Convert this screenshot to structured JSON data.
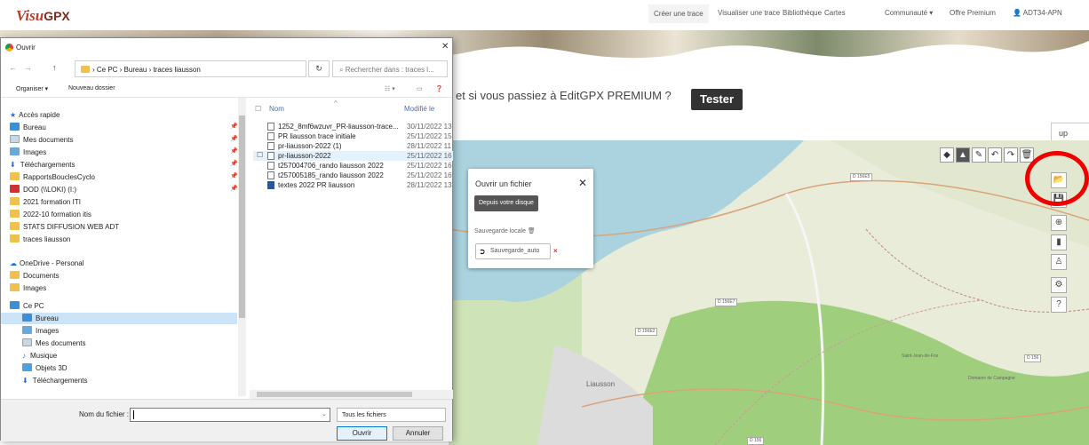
{
  "app": {
    "logo_main": "Visu",
    "logo_gpx": "GPX"
  },
  "topnav": {
    "items": [
      "Créer une trace",
      "Visualiser une trace",
      "Bibliothèque",
      "Cartes",
      "Communauté ▾",
      "Offre Premium"
    ],
    "user": "ADT34-APN"
  },
  "promo": {
    "text": "et si vous passiez à EditGPX PREMIUM ?",
    "button": "Tester"
  },
  "map": {
    "up_button": "up",
    "toolbar": [
      "◆",
      "▲",
      "✎",
      "↶",
      "↷",
      "🗑"
    ],
    "side_tools": [
      "📂",
      "💾",
      "⊕",
      "▮",
      "♙",
      "⚙",
      "?"
    ],
    "road_labels": [
      "D 156E5",
      "D 156E7",
      "D 156E2",
      "D 156",
      "D 156"
    ],
    "places": [
      "Liausson",
      "Domaine de Campagne",
      "Saint-Jean-de-Fos"
    ]
  },
  "popup": {
    "title": "Ouvrir un fichier",
    "close": "✕",
    "disk_button": "Depuis votre disque",
    "local_save_label": "Sauvegarde locale 🗑",
    "save_item": "Sauvegarde_auto",
    "remove": "×"
  },
  "dialog": {
    "title": "Ouvrir",
    "close": "✕",
    "nav_back": "←",
    "nav_forward": "→",
    "nav_up": "↑",
    "breadcrumb": "›  Ce PC  ›  Bureau  ›  traces liausson",
    "refresh": "↻",
    "search_placeholder": "⌕  Rechercher dans : traces l...",
    "organize": "Organiser ▾",
    "new_folder": "Nouveau dossier",
    "nav_pane": {
      "quick_access": "Accès rapide",
      "items": [
        "Bureau",
        "Mes documents",
        "Images",
        "Téléchargements",
        "RapportsBouclesCyclo",
        "DOD (\\\\LOKI) (I:)",
        "2021 formation ITI",
        "2022-10 formation itis",
        "STATS DIFFUSION WEB ADT",
        "traces liausson"
      ],
      "onedrive": "OneDrive - Personal",
      "onedrive_items": [
        "Documents",
        "Images"
      ],
      "this_pc": "Ce PC",
      "pc_items": [
        "Bureau",
        "Images",
        "Mes documents",
        "Musique",
        "Objets 3D",
        "Téléchargements"
      ]
    },
    "columns": {
      "name": "Nom",
      "modified": "Modifié le"
    },
    "files": [
      {
        "name": "1252_8mf6wzuvr_PR-liausson-trace...",
        "date": "30/11/2022 13"
      },
      {
        "name": "PR liausson trace initiale",
        "date": "25/11/2022 15"
      },
      {
        "name": "pr-liausson-2022 (1)",
        "date": "28/11/2022 11"
      },
      {
        "name": "pr-liausson-2022",
        "date": "25/11/2022 16"
      },
      {
        "name": "t257004706_rando liausson 2022",
        "date": "25/11/2022 16"
      },
      {
        "name": "t257005185_rando liausson 2022",
        "date": "25/11/2022 16"
      },
      {
        "name": "textes 2022 PR liausson",
        "date": "28/11/2022 13"
      }
    ],
    "filename_label": "Nom du fichier :",
    "filename_value": "",
    "filetype": "Tous les fichiers",
    "open_button": "Ouvrir",
    "cancel_button": "Annuler"
  }
}
